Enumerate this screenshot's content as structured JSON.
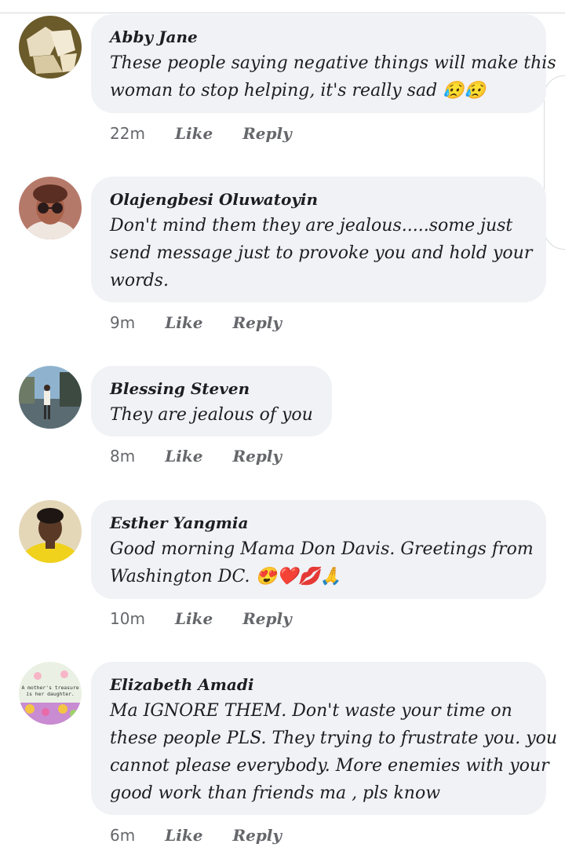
{
  "comments": [
    {
      "author": "Abby Jane",
      "lines": [
        "These people saying negative things will make this",
        "woman to stop helping, it's really sad 😥😥"
      ],
      "time": "22m",
      "like_label": "Like",
      "reply_label": "Reply"
    },
    {
      "author": "Olajengbesi Oluwatoyin",
      "lines": [
        "Don't mind them they are jealous.....some just",
        "send message just to provoke you and hold your",
        "words."
      ],
      "time": "9m",
      "like_label": "Like",
      "reply_label": "Reply"
    },
    {
      "author": "Blessing Steven",
      "lines": [
        "They are jealous of you"
      ],
      "time": "8m",
      "like_label": "Like",
      "reply_label": "Reply"
    },
    {
      "author": "Esther Yangmia",
      "lines": [
        "Good morning Mama Don Davis. Greetings from",
        "Washington DC. 😍❤️💋🙏"
      ],
      "time": "10m",
      "like_label": "Like",
      "reply_label": "Reply"
    },
    {
      "author": "Elizabeth Amadi",
      "lines": [
        "Ma IGNORE THEM. Don't waste your time on",
        "these people PLS. They trying to frustrate you. you",
        "cannot please everybody. More enemies with your",
        "good work than friends ma , pls know"
      ],
      "time": "6m",
      "like_label": "Like",
      "reply_label": "Reply",
      "avatar_text": [
        "A mother's treasure",
        "is her daughter."
      ]
    }
  ],
  "colors": {
    "bubble": "#f0f2f5",
    "text": "#1c1e21",
    "meta": "#65676b"
  }
}
